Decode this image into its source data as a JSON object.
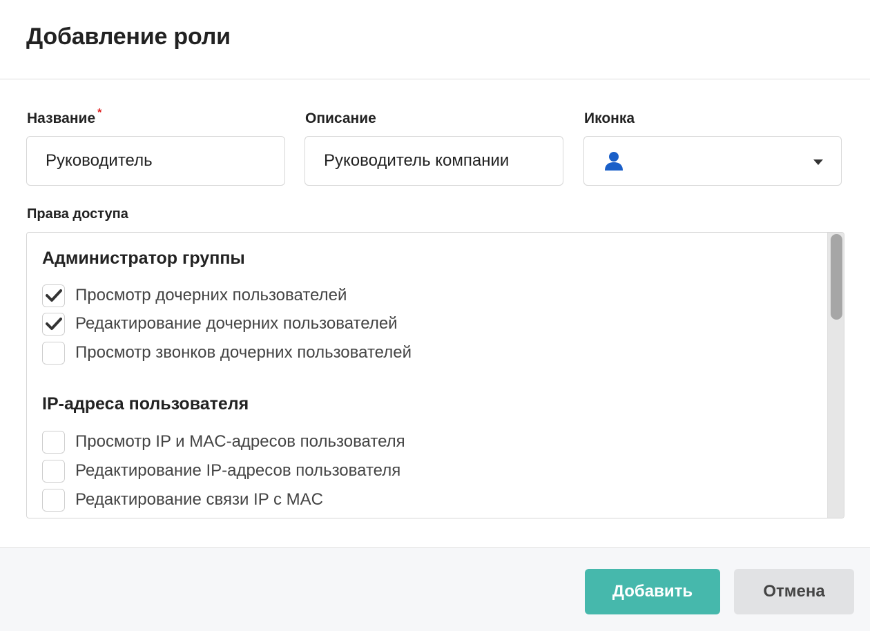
{
  "dialog": {
    "title": "Добавление роли"
  },
  "fields": {
    "name": {
      "label": "Название",
      "required_mark": "*",
      "value": "Руководитель"
    },
    "description": {
      "label": "Описание",
      "value": "Руководитель компании"
    },
    "icon": {
      "label": "Иконка",
      "selected_icon": "user-icon"
    }
  },
  "permissions": {
    "label": "Права доступа",
    "groups": [
      {
        "title": "Администратор группы",
        "items": [
          {
            "label": "Просмотр дочерних пользователей",
            "checked": true
          },
          {
            "label": "Редактирование дочерних пользователей",
            "checked": true
          },
          {
            "label": "Просмотр звонков дочерних пользователей",
            "checked": false
          }
        ]
      },
      {
        "title": "IP-адреса пользователя",
        "items": [
          {
            "label": "Просмотр IP и MAC-адресов пользователя",
            "checked": false
          },
          {
            "label": "Редактирование IP-адресов пользователя",
            "checked": false
          },
          {
            "label": "Редактирование связи IP с MAC",
            "checked": false
          }
        ]
      }
    ]
  },
  "footer": {
    "submit_label": "Добавить",
    "cancel_label": "Отмена"
  },
  "colors": {
    "primary_button": "#46b8ac",
    "secondary_button": "#e1e2e4",
    "icon_blue": "#1a5fc8",
    "required_star": "#e02020"
  }
}
